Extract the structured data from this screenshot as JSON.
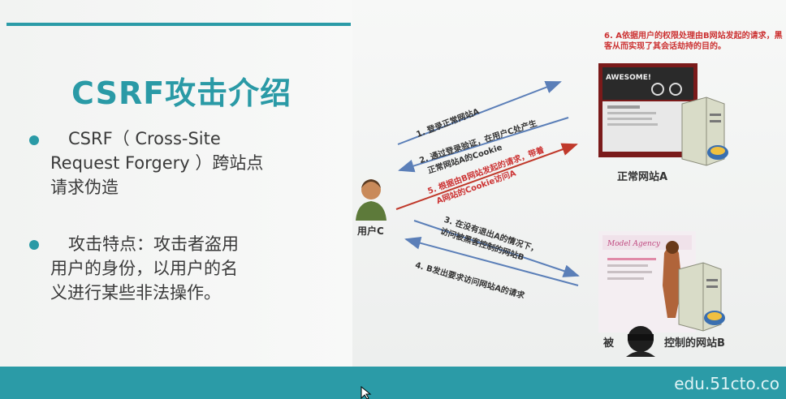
{
  "slide": {
    "title": "CSRF攻击介绍",
    "bullets": [
      {
        "lines": [
          "CSRF（ Cross-Site",
          "Request Forgery ）跨站点",
          "请求伪造"
        ]
      },
      {
        "lines": [
          "攻击特点：攻击者盗用",
          "用户的身份，以用户的名",
          "义进行某些非法操作。"
        ]
      }
    ]
  },
  "diagram": {
    "user_label": "用户C",
    "site_a_label": "正常网站A",
    "site_b_label_pre": "被",
    "site_b_label_post": "控制的网站B",
    "steps": [
      {
        "lines": [
          "1. 登录正常网站A"
        ]
      },
      {
        "lines": [
          "2. 通过登录验证，在用户C处产生",
          "正常网站A的Cookie"
        ]
      },
      {
        "lines": [
          "5. 根据由B网站发起的请求，带着",
          "A网站的Cookie访问A"
        ]
      },
      {
        "lines": [
          "3. 在没有退出A的情况下，",
          "访问被黑客控制的网站B"
        ]
      },
      {
        "lines": [
          "4. B发出要求访问网站A的请求"
        ]
      }
    ],
    "note_6": "6. A依据用户的权限处理由B网站发起的请求，黑客从而实现了其会话劫持的目的。",
    "site_a_banner": "AWESOME!",
    "site_b_banner": "Model Agency"
  },
  "footer": {
    "watermark": "edu.51cto.co"
  },
  "colors": {
    "accent": "#2b9ba7",
    "arrow_blue": "#5b7fb8",
    "arrow_red": "#c0392b"
  }
}
